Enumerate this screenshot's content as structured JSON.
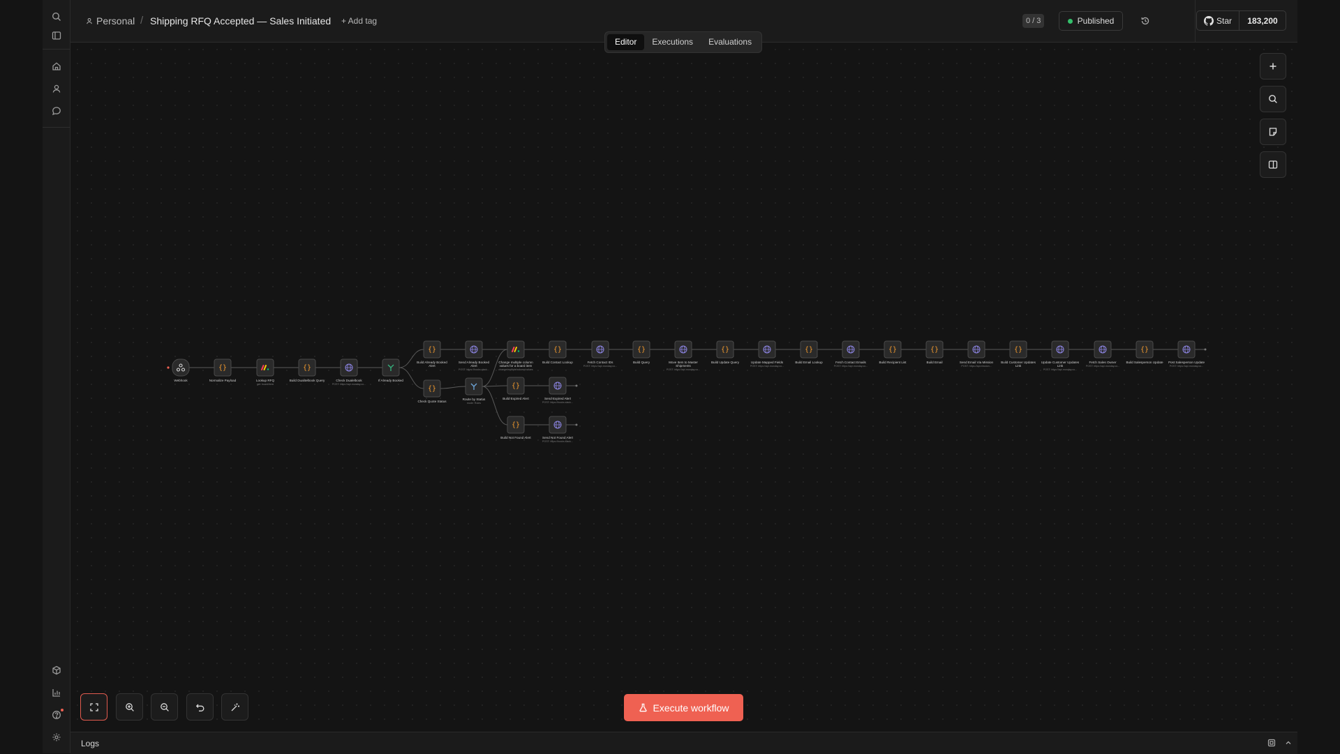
{
  "breadcrumb": {
    "workspace": "Personal",
    "separator": "/",
    "title": "Shipping RFQ Accepted — Sales Initiated",
    "add_tag": "+ Add tag"
  },
  "header": {
    "counter": "0 / 3",
    "status": "Published",
    "github": {
      "star_label": "Star",
      "star_count": "183,200"
    }
  },
  "tabs": [
    {
      "label": "Editor",
      "active": true
    },
    {
      "label": "Executions"
    },
    {
      "label": "Evaluations"
    }
  ],
  "execute": {
    "label": "Execute workflow"
  },
  "logs": {
    "label": "Logs"
  },
  "colors": {
    "accent": "#ef6152",
    "published": "#34c06b",
    "code_node": "#f29a2e",
    "http_node": "#8e86e6",
    "if_node": "#36b37e"
  },
  "nodes": [
    {
      "label": "Webhook",
      "sub": "",
      "kind": "webhook"
    },
    {
      "label": "Normalize Payload",
      "sub": "",
      "kind": "code"
    },
    {
      "label": "Lookup RFQ",
      "sub": "get: board/item",
      "kind": "monday"
    },
    {
      "label": "Build Dualitelbook Query",
      "sub": "",
      "kind": "code"
    },
    {
      "label": "Check Dualelbook",
      "sub": "POST: https://api.monday.co...",
      "kind": "http"
    },
    {
      "label": "If Already Booked",
      "sub": "",
      "kind": "if"
    },
    {
      "label": "Build Already Booked Alert",
      "sub": "",
      "kind": "code"
    },
    {
      "label": "Send Already Booked Alert",
      "sub": "POST: https://hooks.slack...",
      "kind": "http"
    },
    {
      "label": "Change multiple column values for a board item",
      "sub": "change/multiple/column/values",
      "kind": "monday"
    },
    {
      "label": "Build Contact Lookup",
      "sub": "",
      "kind": "code"
    },
    {
      "label": "Fetch Contact IDs",
      "sub": "POST: https://api.monday.co...",
      "kind": "http"
    },
    {
      "label": "Build Query",
      "sub": "",
      "kind": "code"
    },
    {
      "label": "Move Item to Master Shipments",
      "sub": "POST: https://api.monday.co...",
      "kind": "http"
    },
    {
      "label": "Build Update Query",
      "sub": "",
      "kind": "code"
    },
    {
      "label": "Update Mapped Fields",
      "sub": "POST: https://api.monday.co...",
      "kind": "http"
    },
    {
      "label": "Build Email Lookup",
      "sub": "",
      "kind": "code"
    },
    {
      "label": "Fetch Contact Emails",
      "sub": "POST: https://api.monday.co...",
      "kind": "http"
    },
    {
      "label": "Build Recipient List",
      "sub": "",
      "kind": "code"
    },
    {
      "label": "Build Email",
      "sub": "",
      "kind": "code"
    },
    {
      "label": "Send Email Via Mission",
      "sub": "POST: https://api.mission...",
      "kind": "http"
    },
    {
      "label": "Build Customer Updates Link",
      "sub": "",
      "kind": "code"
    },
    {
      "label": "Update Customer Updates Link",
      "sub": "POST: https://api.monday.co...",
      "kind": "http"
    },
    {
      "label": "Fetch Sales Owner",
      "sub": "POST: https://api.monday.co...",
      "kind": "http"
    },
    {
      "label": "Build Salesperson Update",
      "sub": "",
      "kind": "code"
    },
    {
      "label": "Post Salesperson Update",
      "sub": "POST: https://api.monday.co...",
      "kind": "http"
    },
    {
      "label": "Check Quote Status",
      "sub": "",
      "kind": "code"
    },
    {
      "label": "Route by Status",
      "sub": "mode: Rules",
      "kind": "switch"
    },
    {
      "label": "Build Expired Alert",
      "sub": "",
      "kind": "code"
    },
    {
      "label": "Send Expired Alert",
      "sub": "POST: https://hooks.slack...",
      "kind": "http"
    },
    {
      "label": "Build Not Found Alert",
      "sub": "",
      "kind": "code"
    },
    {
      "label": "Send Not Found Alert",
      "sub": "POST: https://hooks.slack...",
      "kind": "http"
    }
  ]
}
